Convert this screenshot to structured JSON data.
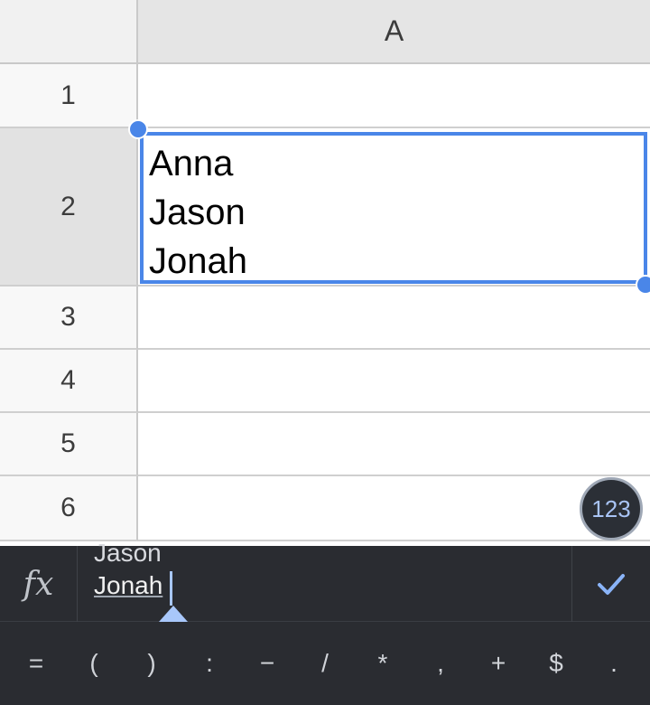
{
  "sheet": {
    "column_header": "A",
    "rows": [
      {
        "label": "1",
        "value": ""
      },
      {
        "label": "2",
        "value": [
          "Anna",
          "Jason",
          "Jonah"
        ]
      },
      {
        "label": "3",
        "value": ""
      },
      {
        "label": "4",
        "value": ""
      },
      {
        "label": "5",
        "value": ""
      },
      {
        "label": "6",
        "value": ""
      }
    ],
    "selected_row": "2",
    "accent_color": "#4a86e8"
  },
  "fab": {
    "label": "123"
  },
  "formula_bar": {
    "fx_label": "fx",
    "previous_line": "Jason",
    "current_line": "Jonah",
    "confirm_icon": "check-icon"
  },
  "symbols": [
    "=",
    "(",
    ")",
    ":",
    "−",
    "/",
    "*",
    ",",
    "+",
    "$",
    "."
  ]
}
